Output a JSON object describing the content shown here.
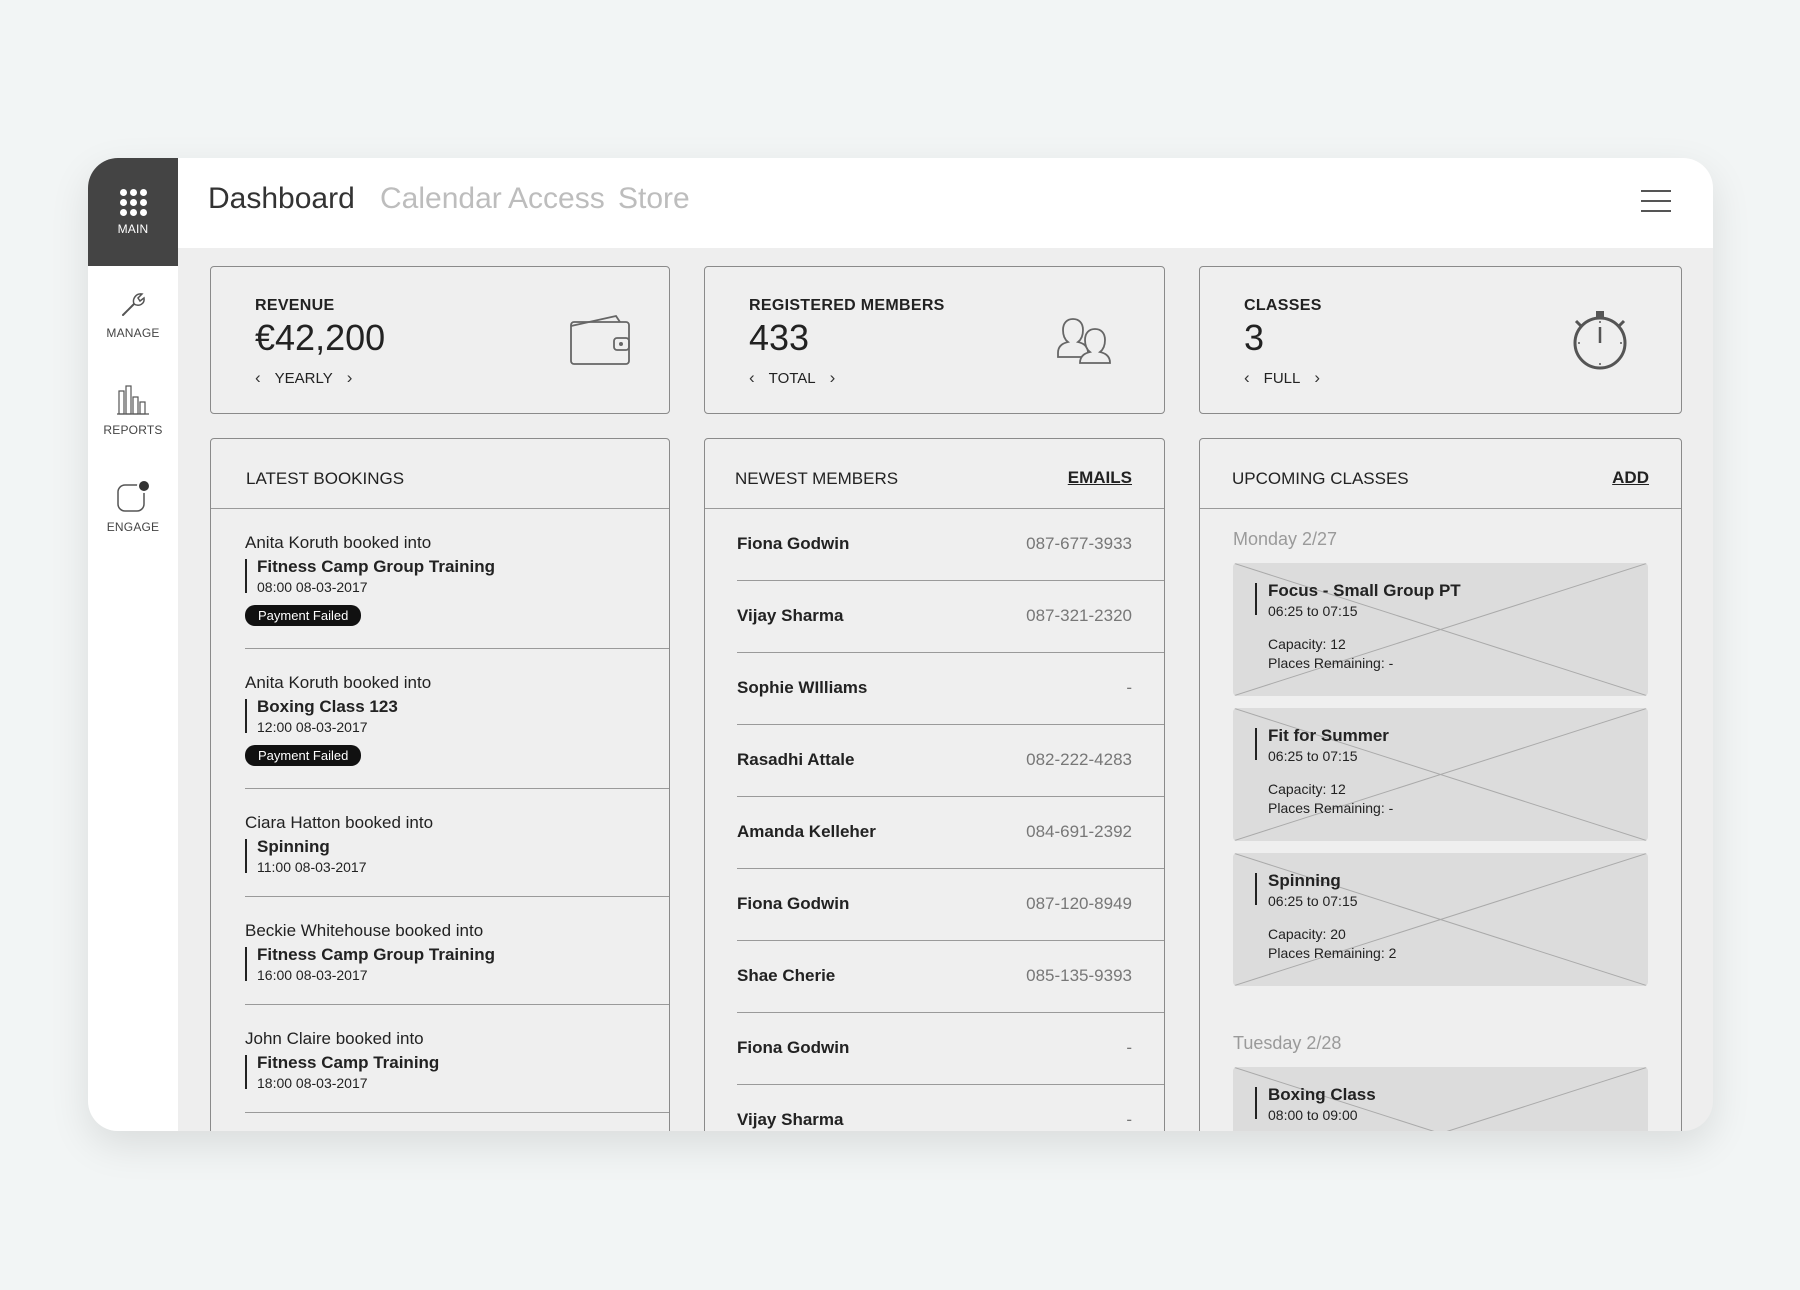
{
  "sidebar": {
    "items": [
      {
        "label": "MAIN",
        "icon": "apps-grid-icon"
      },
      {
        "label": "MANAGE",
        "icon": "wrench-icon"
      },
      {
        "label": "REPORTS",
        "icon": "bar-chart-icon"
      },
      {
        "label": "ENGAGE",
        "icon": "notification-dot-icon"
      }
    ]
  },
  "nav": {
    "tabs": [
      "Dashboard",
      "Calendar",
      "Access",
      "Store"
    ],
    "active": "Dashboard",
    "menu_icon": "hamburger-menu-icon"
  },
  "stats": {
    "revenue": {
      "title": "REVENUE",
      "value": "€42,200",
      "period": "YEARLY",
      "icon": "wallet-icon"
    },
    "members": {
      "title": "REGISTERED MEMBERS",
      "value": "433",
      "period": "TOTAL",
      "icon": "users-icon"
    },
    "classes": {
      "title": "CLASSES",
      "value": "3",
      "period": "FULL",
      "icon": "stopwatch-icon"
    }
  },
  "bookings": {
    "title": "LATEST BOOKINGS",
    "items": [
      {
        "who": "Anita Koruth booked into",
        "class": "Fitness Camp Group Training",
        "time": "08:00 08-03-2017",
        "badge": "Payment Failed"
      },
      {
        "who": "Anita Koruth booked into",
        "class": "Boxing Class 123",
        "time": "12:00 08-03-2017",
        "badge": "Payment Failed"
      },
      {
        "who": "Ciara Hatton booked into",
        "class": "Spinning",
        "time": "11:00 08-03-2017",
        "badge": ""
      },
      {
        "who": "Beckie Whitehouse booked into",
        "class": "Fitness Camp Group Training",
        "time": "16:00 08-03-2017",
        "badge": ""
      },
      {
        "who": "John Claire booked into",
        "class": "Fitness Camp Training",
        "time": "18:00 08-03-2017",
        "badge": ""
      }
    ]
  },
  "members": {
    "title": "NEWEST MEMBERS",
    "action": "EMAILS",
    "items": [
      {
        "name": "Fiona Godwin",
        "phone": "087-677-3933"
      },
      {
        "name": "Vijay Sharma",
        "phone": "087-321-2320"
      },
      {
        "name": "Sophie WIlliams",
        "phone": "-"
      },
      {
        "name": "Rasadhi Attale",
        "phone": "082-222-4283"
      },
      {
        "name": "Amanda Kelleher",
        "phone": "084-691-2392"
      },
      {
        "name": "Fiona Godwin",
        "phone": "087-120-8949"
      },
      {
        "name": "Shae Cherie",
        "phone": "085-135-9393"
      },
      {
        "name": "Fiona Godwin",
        "phone": "-"
      },
      {
        "name": "Vijay Sharma",
        "phone": "-"
      }
    ]
  },
  "upcoming": {
    "title": "UPCOMING CLASSES",
    "action": "ADD",
    "days": [
      {
        "label": "Monday 2/27",
        "classes": [
          {
            "name": "Focus - Small Group PT",
            "time": "06:25 to 07:15",
            "capacity": "Capacity: 12",
            "remaining": "Places Remaining: -"
          },
          {
            "name": "Fit for Summer",
            "time": "06:25 to 07:15",
            "capacity": "Capacity: 12",
            "remaining": "Places Remaining: -"
          },
          {
            "name": "Spinning",
            "time": "06:25 to 07:15",
            "capacity": "Capacity: 20",
            "remaining": "Places Remaining: 2"
          }
        ]
      },
      {
        "label": "Tuesday 2/28",
        "classes": [
          {
            "name": "Boxing Class",
            "time": "08:00 to 09:00",
            "capacity": "",
            "remaining": ""
          }
        ]
      }
    ]
  },
  "colors": {
    "sidebar_active": "#444444",
    "badge": "#111111",
    "panel_bg": "#efefef",
    "class_box": "#dcdcdc",
    "inactive_tab": "#bdbdbd"
  }
}
